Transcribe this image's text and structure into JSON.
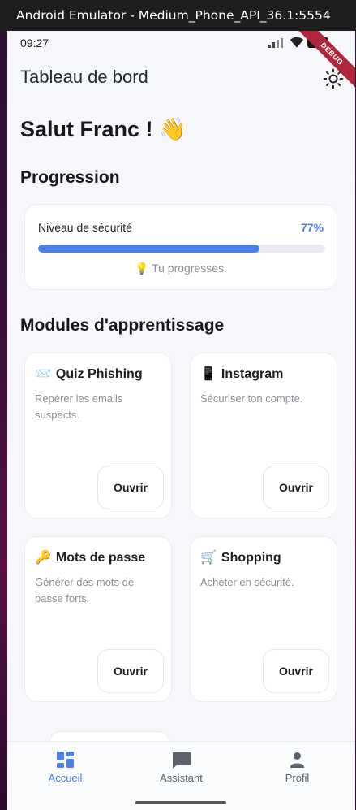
{
  "window": {
    "title": "Android Emulator - Medium_Phone_API_36.1:5554"
  },
  "status_bar": {
    "time": "09:27",
    "debug_banner": "DEBUG"
  },
  "app_bar": {
    "title": "Tableau de bord",
    "theme_icon": "sun-icon"
  },
  "greeting": "Salut Franc ! 👋",
  "progress": {
    "heading": "Progression",
    "label": "Niveau de sécurité",
    "percent_text": "77%",
    "value": 0.77,
    "hint": "💡 Tu progresses.",
    "accent": "#4d7ef0"
  },
  "modules": {
    "heading": "Modules d'apprentissage",
    "items": [
      {
        "emoji": "📨",
        "title": "Quiz Phishing",
        "desc": "Repérer les emails suspects.",
        "button": "Ouvrir"
      },
      {
        "emoji": "📱",
        "title": "Instagram",
        "desc": "Sécuriser ton compte.",
        "button": "Ouvrir"
      },
      {
        "emoji": "🔑",
        "title": "Mots de passe",
        "desc": "Générer des mots de passe forts.",
        "button": "Ouvrir"
      },
      {
        "emoji": "🛒",
        "title": "Shopping",
        "desc": "Acheter en sécurité.",
        "button": "Ouvrir"
      }
    ]
  },
  "bottom_nav": {
    "items": [
      {
        "label": "Accueil",
        "icon": "dashboard-icon",
        "active": true
      },
      {
        "label": "Assistant",
        "icon": "chat-icon",
        "active": false
      },
      {
        "label": "Profil",
        "icon": "person-icon",
        "active": false
      }
    ],
    "active_color": "#4f7fe6",
    "inactive_color": "#5d636e"
  }
}
